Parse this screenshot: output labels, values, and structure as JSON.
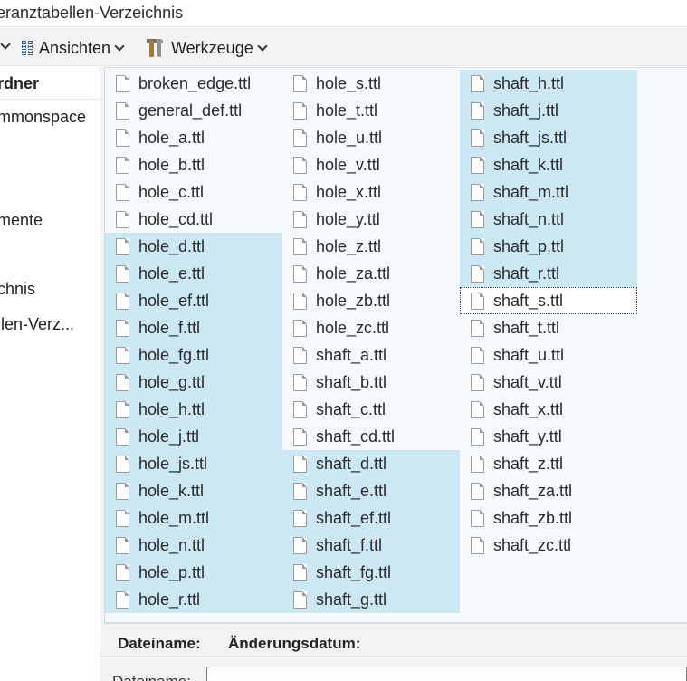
{
  "window": {
    "title": "eranztabellen-Verzeichnis"
  },
  "toolbar": {
    "views_label": "Ansichten",
    "tools_label": "Werkzeuge"
  },
  "nav": {
    "header": "rdner",
    "items": [
      "mmonspace",
      "mente",
      "chnis",
      "llen-Verz..."
    ]
  },
  "columns": [
    [
      {
        "name": "broken_edge.ttl",
        "selected": false
      },
      {
        "name": "general_def.ttl",
        "selected": false
      },
      {
        "name": "hole_a.ttl",
        "selected": false
      },
      {
        "name": "hole_b.ttl",
        "selected": false
      },
      {
        "name": "hole_c.ttl",
        "selected": false
      },
      {
        "name": "hole_cd.ttl",
        "selected": false
      },
      {
        "name": "hole_d.ttl",
        "selected": true
      },
      {
        "name": "hole_e.ttl",
        "selected": true
      },
      {
        "name": "hole_ef.ttl",
        "selected": true
      },
      {
        "name": "hole_f.ttl",
        "selected": true
      },
      {
        "name": "hole_fg.ttl",
        "selected": true
      },
      {
        "name": "hole_g.ttl",
        "selected": true
      },
      {
        "name": "hole_h.ttl",
        "selected": true
      },
      {
        "name": "hole_j.ttl",
        "selected": true
      },
      {
        "name": "hole_js.ttl",
        "selected": true
      },
      {
        "name": "hole_k.ttl",
        "selected": true
      },
      {
        "name": "hole_m.ttl",
        "selected": true
      },
      {
        "name": "hole_n.ttl",
        "selected": true
      },
      {
        "name": "hole_p.ttl",
        "selected": true
      },
      {
        "name": "hole_r.ttl",
        "selected": true
      }
    ],
    [
      {
        "name": "hole_s.ttl",
        "selected": false
      },
      {
        "name": "hole_t.ttl",
        "selected": false
      },
      {
        "name": "hole_u.ttl",
        "selected": false
      },
      {
        "name": "hole_v.ttl",
        "selected": false
      },
      {
        "name": "hole_x.ttl",
        "selected": false
      },
      {
        "name": "hole_y.ttl",
        "selected": false
      },
      {
        "name": "hole_z.ttl",
        "selected": false
      },
      {
        "name": "hole_za.ttl",
        "selected": false
      },
      {
        "name": "hole_zb.ttl",
        "selected": false
      },
      {
        "name": "hole_zc.ttl",
        "selected": false
      },
      {
        "name": "shaft_a.ttl",
        "selected": false
      },
      {
        "name": "shaft_b.ttl",
        "selected": false
      },
      {
        "name": "shaft_c.ttl",
        "selected": false
      },
      {
        "name": "shaft_cd.ttl",
        "selected": false
      },
      {
        "name": "shaft_d.ttl",
        "selected": true
      },
      {
        "name": "shaft_e.ttl",
        "selected": true
      },
      {
        "name": "shaft_ef.ttl",
        "selected": true
      },
      {
        "name": "shaft_f.ttl",
        "selected": true
      },
      {
        "name": "shaft_fg.ttl",
        "selected": true
      },
      {
        "name": "shaft_g.ttl",
        "selected": true
      }
    ],
    [
      {
        "name": "shaft_h.ttl",
        "selected": true
      },
      {
        "name": "shaft_j.ttl",
        "selected": true
      },
      {
        "name": "shaft_js.ttl",
        "selected": true
      },
      {
        "name": "shaft_k.ttl",
        "selected": true
      },
      {
        "name": "shaft_m.ttl",
        "selected": true
      },
      {
        "name": "shaft_n.ttl",
        "selected": true
      },
      {
        "name": "shaft_p.ttl",
        "selected": true
      },
      {
        "name": "shaft_r.ttl",
        "selected": true
      },
      {
        "name": "shaft_s.ttl",
        "selected": true,
        "focused": true
      },
      {
        "name": "shaft_t.ttl",
        "selected": false
      },
      {
        "name": "shaft_u.ttl",
        "selected": false
      },
      {
        "name": "shaft_v.ttl",
        "selected": false
      },
      {
        "name": "shaft_x.ttl",
        "selected": false
      },
      {
        "name": "shaft_y.ttl",
        "selected": false
      },
      {
        "name": "shaft_z.ttl",
        "selected": false
      },
      {
        "name": "shaft_za.ttl",
        "selected": false
      },
      {
        "name": "shaft_zb.ttl",
        "selected": false
      },
      {
        "name": "shaft_zc.ttl",
        "selected": false
      }
    ]
  ],
  "details": {
    "name_label": "Dateiname:",
    "date_label": "Änderungsdatum:"
  },
  "bottom": {
    "filename_label": "Dateiname:",
    "filename_value": ""
  },
  "colors": {
    "selection": "#cce8f4",
    "list_background": "#f5f9fc"
  }
}
